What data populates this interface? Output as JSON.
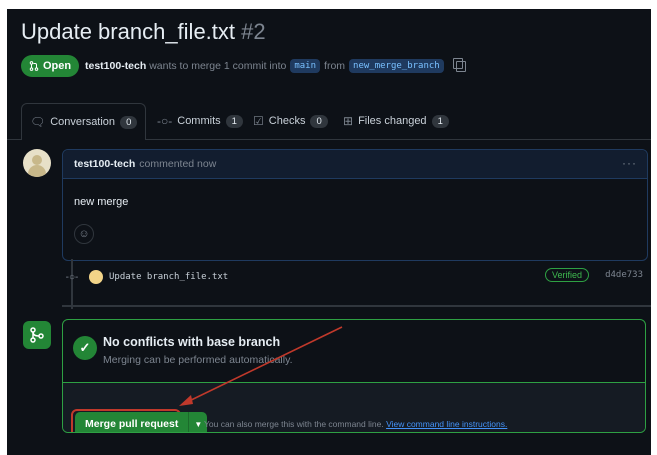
{
  "pr": {
    "title": "Update branch_file.txt",
    "number": "#2",
    "state": "Open",
    "author": "test100-tech",
    "merge_text": "wants to merge 1 commit into",
    "base_branch": "main",
    "from_text": "from",
    "head_branch": "new_merge_branch"
  },
  "tabs": [
    {
      "label": "Conversation",
      "count": "0",
      "icon": "comment-icon"
    },
    {
      "label": "Commits",
      "count": "1",
      "icon": "commit-icon"
    },
    {
      "label": "Checks",
      "count": "0",
      "icon": "checklist-icon"
    },
    {
      "label": "Files changed",
      "count": "1",
      "icon": "file-diff-icon"
    }
  ],
  "comment": {
    "author": "test100-tech",
    "action": "commented now",
    "body": "new merge"
  },
  "commit": {
    "message": "Update branch_file.txt",
    "badge": "Verified",
    "sha": "d4de733"
  },
  "merge": {
    "title": "No conflicts with base branch",
    "subtitle": "Merging can be performed automatically.",
    "button": "Merge pull request",
    "cli_text": "You can also merge this with the command line.",
    "cli_link": "View command line instructions."
  },
  "colors": {
    "background": "#0d1117",
    "success": "#238636",
    "link": "#4493f8",
    "annotation": "#c0392b"
  }
}
